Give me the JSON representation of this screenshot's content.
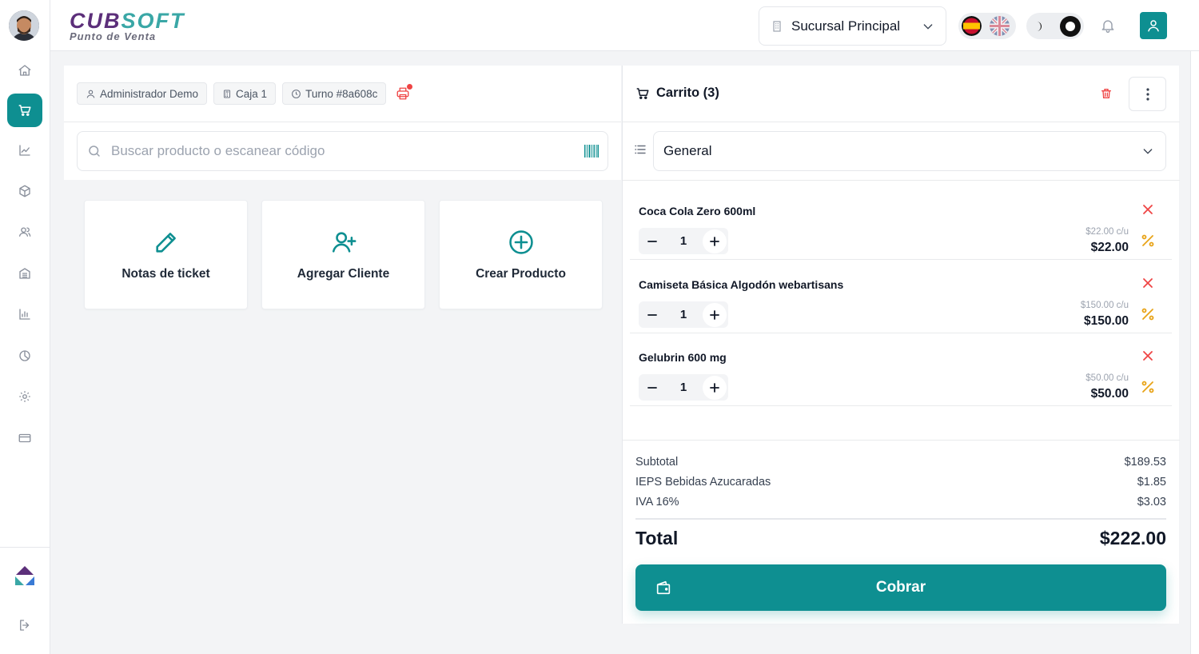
{
  "sidebar": {
    "items": [
      {
        "name": "home",
        "icon": "home-icon",
        "active": false
      },
      {
        "name": "pos",
        "icon": "cart-icon",
        "active": true
      },
      {
        "name": "sales",
        "icon": "trend-icon",
        "active": false
      },
      {
        "name": "products",
        "icon": "box-icon",
        "active": false
      },
      {
        "name": "customers",
        "icon": "users-icon",
        "active": false
      },
      {
        "name": "branches",
        "icon": "building-icon",
        "active": false
      },
      {
        "name": "reports",
        "icon": "bar-chart-icon",
        "active": false
      },
      {
        "name": "analytics",
        "icon": "pie-chart-icon",
        "active": false
      },
      {
        "name": "settings",
        "icon": "gear-icon",
        "active": false
      },
      {
        "name": "payments",
        "icon": "credit-card-icon",
        "active": false
      }
    ],
    "bottom": [
      {
        "name": "brand",
        "icon": "cubosoft-logo-icon"
      },
      {
        "name": "logout",
        "icon": "logout-icon"
      }
    ]
  },
  "header": {
    "logo_part1": "CUB",
    "logo_part2": "SOFT",
    "logo_subtitle": "Punto de Venta",
    "branch": "Sucursal Principal"
  },
  "session": {
    "user": "Administrador Demo",
    "register": "Caja 1",
    "shift": "Turno #8a608c"
  },
  "search": {
    "placeholder": "Buscar producto o escanear código"
  },
  "actions": [
    {
      "label": "Notas de ticket",
      "icon": "pencil-icon"
    },
    {
      "label": "Agregar Cliente",
      "icon": "add-user-icon"
    },
    {
      "label": "Crear Producto",
      "icon": "plus-circle-icon"
    }
  ],
  "cart": {
    "title": "Carrito (3)",
    "price_list": "General",
    "items": [
      {
        "name": "Coca Cola Zero 600ml",
        "qty": "1",
        "unit_price": "$22.00 c/u",
        "total": "$22.00"
      },
      {
        "name": "Camiseta Básica Algodón webartisans",
        "qty": "1",
        "unit_price": "$150.00 c/u",
        "total": "$150.00"
      },
      {
        "name": "Gelubrin 600 mg",
        "qty": "1",
        "unit_price": "$50.00 c/u",
        "total": "$50.00"
      }
    ],
    "summary": {
      "subtotal_label": "Subtotal",
      "subtotal": "$189.53",
      "ieps_label": "IEPS Bebidas Azucaradas",
      "ieps": "$1.85",
      "iva_label": "IVA 16%",
      "iva": "$3.03",
      "total_label": "Total",
      "total": "$222.00"
    },
    "pay_label": "Cobrar"
  },
  "colors": {
    "accent": "#0e8f91",
    "danger": "#ef4444",
    "discount": "#e8a317",
    "brand_purple": "#5c2f7a",
    "brand_teal": "#3aa7a6"
  }
}
